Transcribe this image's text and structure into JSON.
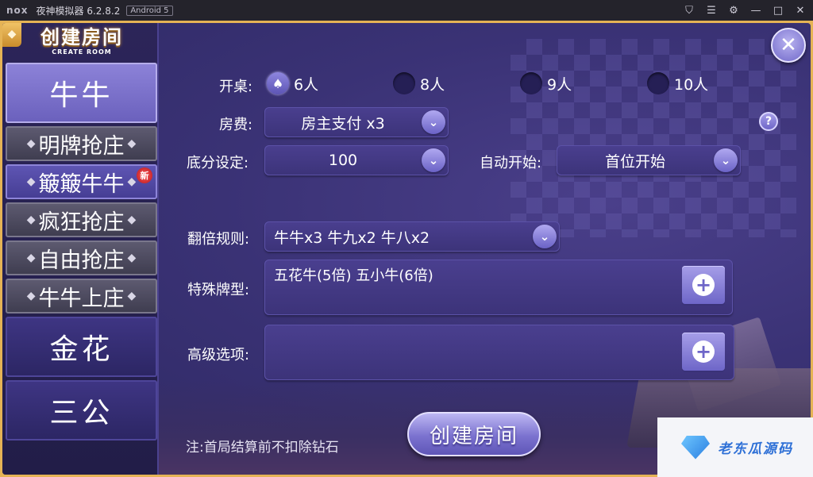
{
  "titlebar": {
    "logo": "nox",
    "title": "夜神模拟器 6.2.8.2",
    "android": "Android 5",
    "icons": [
      "shirt-icon",
      "menu-icon",
      "gear-icon",
      "minimize-icon",
      "maximize-icon",
      "close-icon"
    ],
    "icon_glyphs": [
      "⛉",
      "☰",
      "⚙",
      "—",
      "□",
      "✕"
    ]
  },
  "header": {
    "title": "创建房间",
    "subtitle": "CREATE ROOM"
  },
  "sidebar": {
    "items": [
      {
        "label": "牛牛",
        "type": "big",
        "active": true
      },
      {
        "label": "明牌抢庄",
        "type": "small",
        "active": false
      },
      {
        "label": "簸簸牛牛",
        "type": "small",
        "active": true,
        "badge": "新"
      },
      {
        "label": "疯狂抢庄",
        "type": "small",
        "active": false
      },
      {
        "label": "自由抢庄",
        "type": "small",
        "active": false
      },
      {
        "label": "牛牛上庄",
        "type": "small",
        "active": false
      },
      {
        "label": "金花",
        "type": "big",
        "active": false
      },
      {
        "label": "三公",
        "type": "big",
        "active": false
      }
    ]
  },
  "form": {
    "table_label": "开桌:",
    "players": [
      {
        "label": "6人",
        "selected": true
      },
      {
        "label": "8人",
        "selected": false
      },
      {
        "label": "9人",
        "selected": false
      },
      {
        "label": "10人",
        "selected": false
      }
    ],
    "fee_label": "房费:",
    "fee_value": "房主支付 x3",
    "base_label": "底分设定:",
    "base_value": "100",
    "auto_label": "自动开始:",
    "auto_value": "首位开始",
    "multiplier_label": "翻倍规则:",
    "multiplier_value": "牛牛x3  牛九x2  牛八x2",
    "special_label": "特殊牌型:",
    "special_value": "五花牛(5倍)  五小牛(6倍)",
    "advanced_label": "高级选项:",
    "advanced_value": "",
    "help": "?",
    "plus": "+",
    "chevron": "⌄"
  },
  "create_button": "创建房间",
  "note": "注:首局结算前不扣除钻石",
  "close_glyph": "✕",
  "spade_glyph": "♠",
  "diamond_glyph": "◆",
  "watermark": "老东瓜源码",
  "colors": {
    "accent": "#7b72cf",
    "frame": "#e5b355",
    "panel": "#3a3275"
  }
}
